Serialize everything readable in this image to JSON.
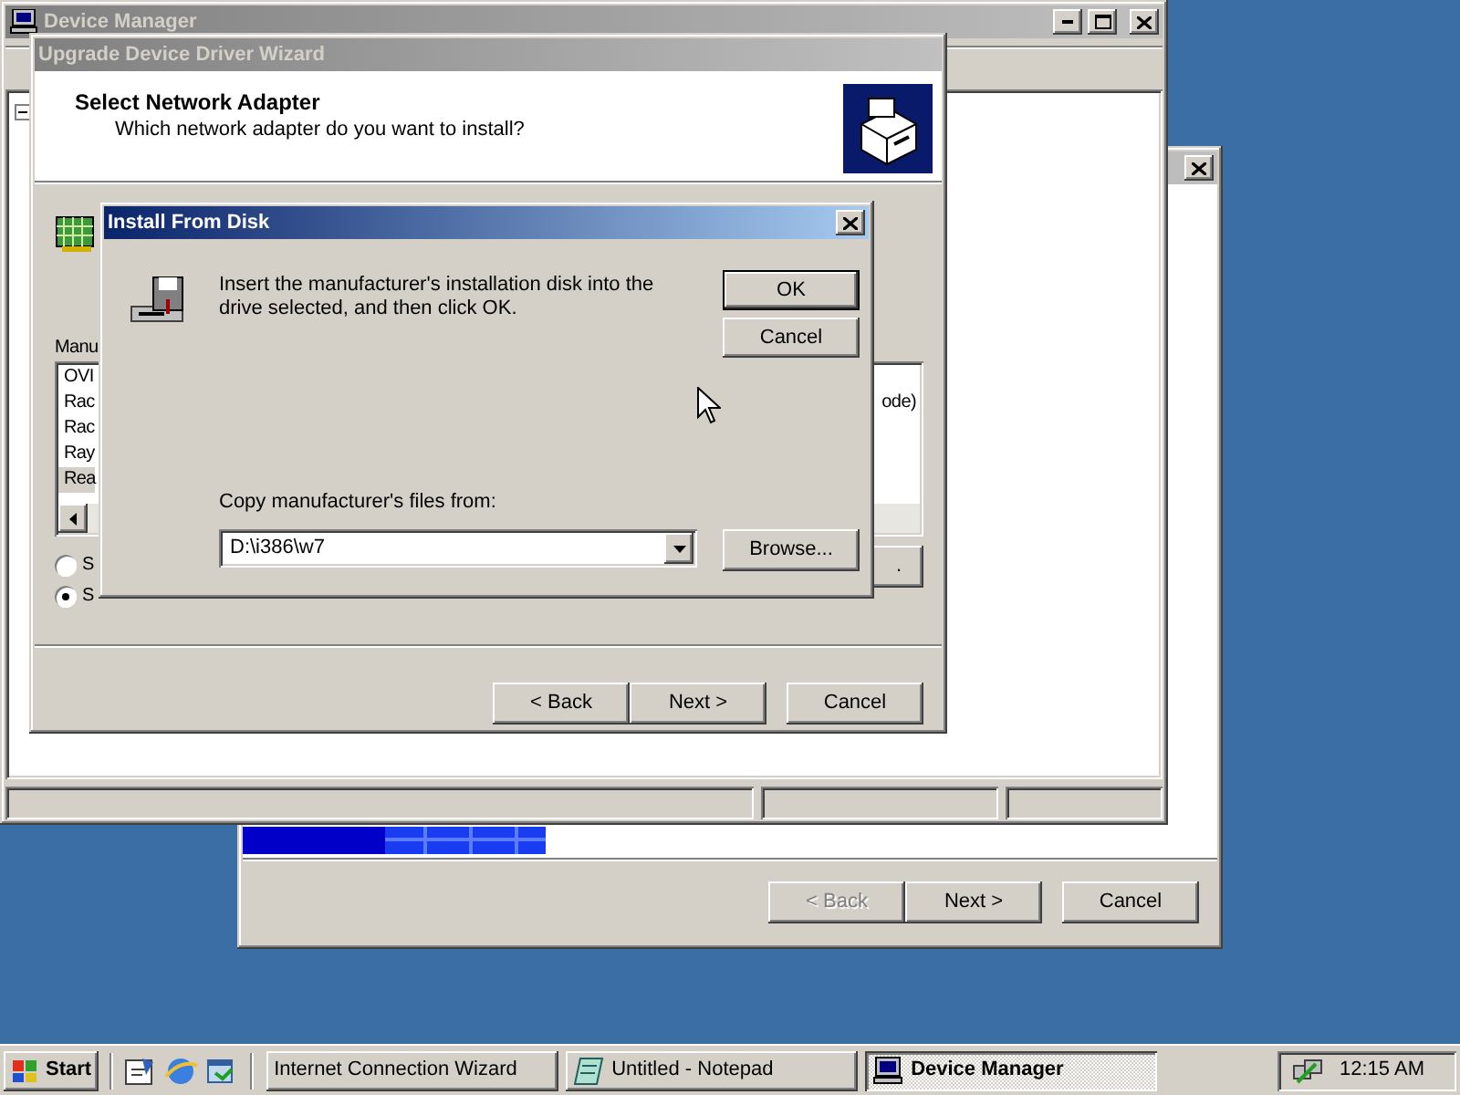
{
  "connection_wizard": {
    "active": false,
    "buttons": [
      {
        "label": "< Back",
        "disabled": true
      },
      {
        "label": "Next >",
        "disabled": false
      },
      {
        "label": "Cancel",
        "disabled": false
      }
    ]
  },
  "device_manager": {
    "title": "Device Manager",
    "active": false
  },
  "driver_wizard": {
    "title": "Upgrade Device Driver Wizard",
    "active": false,
    "heading": "Select Network Adapter",
    "subheading": "Which network adapter do you want to install?",
    "manufacturer_label": "Manu",
    "manufacturers": [
      {
        "label": "OVI",
        "selected": false
      },
      {
        "label": "Rac",
        "selected": false
      },
      {
        "label": "Rac",
        "selected": false
      },
      {
        "label": "Ray",
        "selected": false
      },
      {
        "label": "Rea",
        "selected": true
      }
    ],
    "models": [
      "ode)"
    ],
    "radios": [
      {
        "label": "S",
        "selected": false
      },
      {
        "label": "S",
        "selected": true
      }
    ],
    "side_button": ".",
    "buttons": [
      {
        "label": "< Back",
        "disabled": false
      },
      {
        "label": "Next >",
        "disabled": false
      },
      {
        "label": "Cancel",
        "disabled": false
      }
    ]
  },
  "install_from_disk": {
    "title": "Install From Disk",
    "active": true,
    "message": "Insert the manufacturer's installation disk into the drive selected, and then click OK.",
    "buttons": [
      {
        "label": "OK",
        "default": true
      },
      {
        "label": "Cancel",
        "default": false
      }
    ],
    "copy_label": "Copy manufacturer's files from:",
    "path": "D:\\i386\\w7",
    "browse_button": "Browse..."
  },
  "taskbar": {
    "start": "Start",
    "tasks": [
      {
        "label": "Internet Connection Wizard",
        "selected": false
      },
      {
        "label": "Untitled - Notepad",
        "selected": false
      },
      {
        "label": "Device Manager",
        "selected": true
      }
    ],
    "clock": "12:15 AM"
  }
}
